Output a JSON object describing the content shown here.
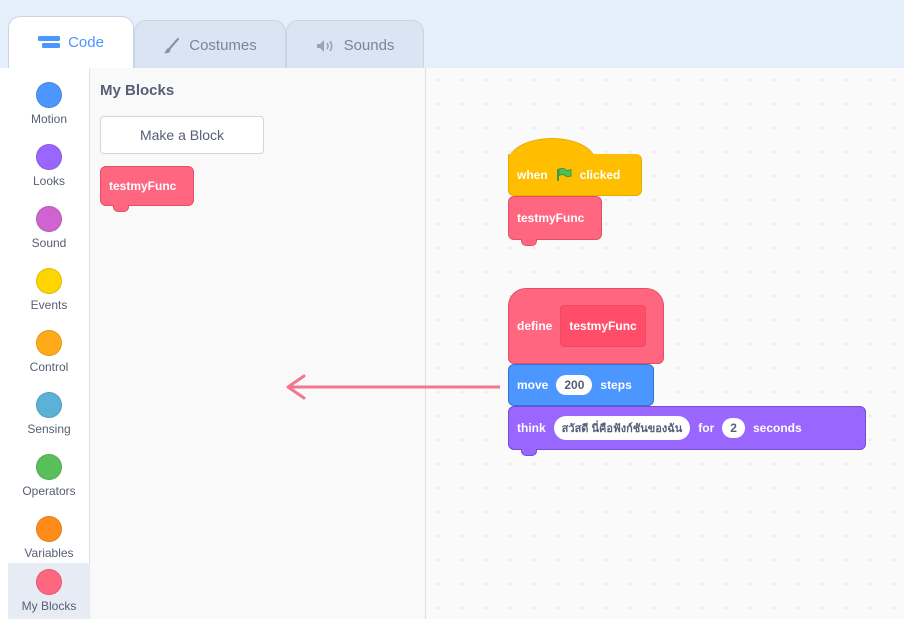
{
  "tabs": {
    "code": "Code",
    "costumes": "Costumes",
    "sounds": "Sounds"
  },
  "categories": [
    {
      "label": "Motion",
      "color": "#4c97ff"
    },
    {
      "label": "Looks",
      "color": "#9966ff"
    },
    {
      "label": "Sound",
      "color": "#cf63cf"
    },
    {
      "label": "Events",
      "color": "#ffd500"
    },
    {
      "label": "Control",
      "color": "#ffab19"
    },
    {
      "label": "Sensing",
      "color": "#5cb1d6"
    },
    {
      "label": "Operators",
      "color": "#59c059"
    },
    {
      "label": "Variables",
      "color": "#ff8c1a"
    },
    {
      "label": "My Blocks",
      "color": "#ff6680"
    }
  ],
  "palette": {
    "title": "My Blocks",
    "make_block": "Make a Block",
    "custom_block": "testmyFunc"
  },
  "script1": {
    "when": "when",
    "clicked": "clicked",
    "call": "testmyFunc"
  },
  "script2": {
    "define": "define",
    "define_name": "testmyFunc",
    "move": "move",
    "move_value": "200",
    "steps": "steps",
    "think": "think",
    "think_text": "สวัสดี นี่คือฟังก์ชันของฉัน",
    "for": "for",
    "seconds_value": "2",
    "seconds": "seconds"
  },
  "colors": {
    "accent": "#4c97ff",
    "my_blocks": "#ff6680",
    "events": "#ffbf00",
    "motion": "#4c97ff",
    "looks": "#9966ff",
    "arrow": "#f07890"
  }
}
